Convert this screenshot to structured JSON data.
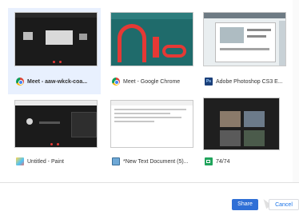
{
  "tiles": [
    {
      "label": "Meet - aaw-wkck-coa...",
      "icon": "chrome-icon",
      "selected": true
    },
    {
      "label": "Meet - Google Chrome",
      "icon": "chrome-icon",
      "selected": false
    },
    {
      "label": "Adobe Photoshop CS3 E...",
      "icon": "photoshop-icon",
      "selected": false
    },
    {
      "label": "Untitled - Paint",
      "icon": "paint-icon",
      "selected": false
    },
    {
      "label": "*New Text Document (5)...",
      "icon": "notepad-icon",
      "selected": false
    },
    {
      "label": "74/74",
      "icon": "meet-icon",
      "selected": false
    }
  ],
  "footer": {
    "share_label": "Share",
    "cancel_label": "Cancel"
  },
  "colors": {
    "accent": "#2f6fd6",
    "selected_bg": "#e8f0fe"
  }
}
